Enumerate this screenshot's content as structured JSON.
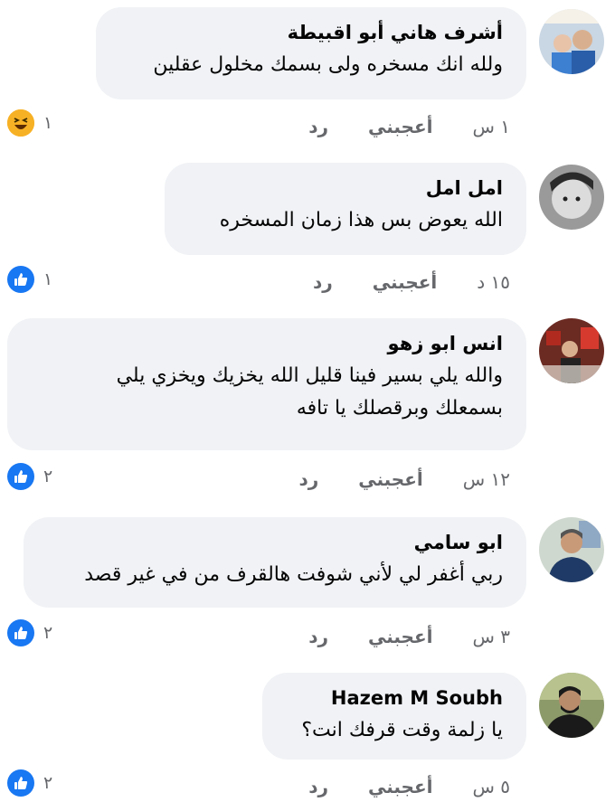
{
  "comments": [
    {
      "author": "أشرف هاني أبو اقبيطة",
      "lines": [
        "ولله انك مسخره ولى بسمك مخلول عقلين"
      ],
      "time": "١ س",
      "like_label": "أعجبني",
      "reply_label": "رد",
      "reaction_count": "١",
      "reaction_icon": "haha-icon"
    },
    {
      "author": "امل امل",
      "lines": [
        "الله يعوض  بس هذا زمان المسخره"
      ],
      "time": "١٥ د",
      "like_label": "أعجبني",
      "reply_label": "رد",
      "reaction_count": "١",
      "reaction_icon": "like-icon"
    },
    {
      "author": "انس ابو زهو",
      "lines": [
        "والله يلي بسير فينا قليل الله يخزيك ويخزي يلي",
        "بسمعلك وبرقصلك يا تافه"
      ],
      "time": "١٢ س",
      "like_label": "أعجبني",
      "reply_label": "رد",
      "reaction_count": "٢",
      "reaction_icon": "like-icon"
    },
    {
      "author": "ابو سامي",
      "lines": [
        "ربي أغفر لي لأني شوفت هالقرف من في غير قصد"
      ],
      "time": "٣ س",
      "like_label": "أعجبني",
      "reply_label": "رد",
      "reaction_count": "٢",
      "reaction_icon": "like-icon"
    },
    {
      "author": "Hazem M Soubh",
      "lines": [
        "يا زلمة وقت قرفك انت؟"
      ],
      "time": "٥ س",
      "like_label": "أعجبني",
      "reply_label": "رد",
      "reaction_count": "٢",
      "reaction_icon": "like-icon"
    }
  ],
  "colors": {
    "bubble": "#f0f2f5",
    "meta_text": "#65676b",
    "like_blue": "#1877f2",
    "haha_yellow": "#f7b125"
  }
}
